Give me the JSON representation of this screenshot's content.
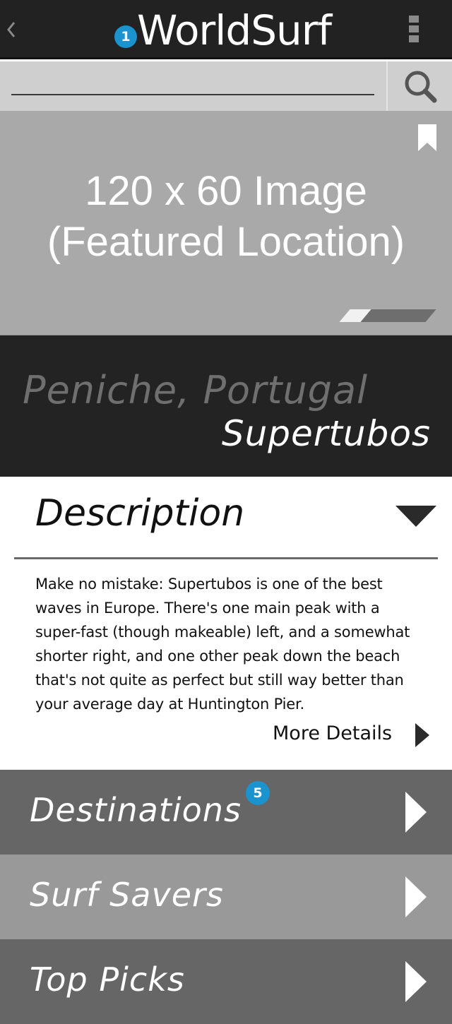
{
  "header": {
    "title": "WorldSurf",
    "notification_count": "1",
    "back_icon": "chevron-left-icon",
    "menu_icon": "kebab-menu-icon"
  },
  "search": {
    "value": "",
    "placeholder": "",
    "icon": "search-icon"
  },
  "featured": {
    "line1": "120 x 60 Image",
    "line2": "(Featured Location)",
    "bookmark_icon": "bookmark-icon",
    "pager": {
      "pages": 5,
      "active_index": 0
    }
  },
  "location": {
    "region": "Peniche, Portugal",
    "spot": "Supertubos"
  },
  "description": {
    "title": "Description",
    "toggle_icon": "caret-down-icon",
    "body": "Make no mistake: Supertubos is one of the best waves in Europe. There's one main peak with a super-fast (though makeable) left, and a somewhat shorter right, and one other peak down the beach that's not quite as perfect but still way better than your average day at Huntington Pier.",
    "more_label": "More Details"
  },
  "menu": [
    {
      "label": "Destinations",
      "badge": "5",
      "bg": "#666666"
    },
    {
      "label": "Surf Savers",
      "badge": "",
      "bg": "#999999"
    },
    {
      "label": "Top Picks",
      "badge": "",
      "bg": "#666666"
    }
  ],
  "colors": {
    "header_bg": "#222222",
    "badge": "#1a93cf",
    "search_bg": "#cfcfcf",
    "featured_bg": "#a9a9a9",
    "location_bg": "#232323"
  }
}
